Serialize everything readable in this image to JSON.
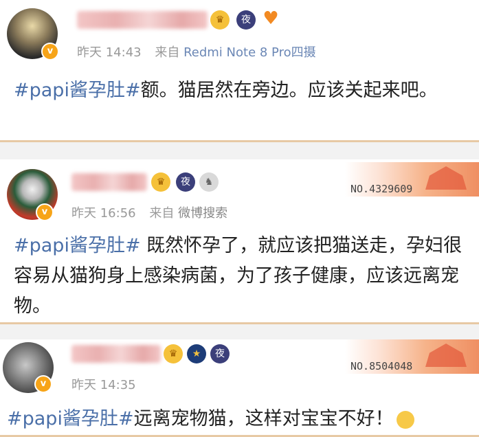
{
  "posts": [
    {
      "time": "昨天 14:43",
      "source_prefix": "来自",
      "source": "Redmi Note 8 Pro四摄",
      "hashtag": "#papi酱孕肚#",
      "text": "额。猫居然在旁边。应该关起来吧。",
      "badges": [
        "crown-icon",
        "night-icon",
        "heart-icon"
      ],
      "verified_mark": "v"
    },
    {
      "time": "昨天 16:56",
      "source_prefix": "来自",
      "source": "微博搜索",
      "hashtag": "#papi酱孕肚#",
      "text": " 既然怀孕了，就应该把猫送走，孕妇很容易从猫狗身上感染病菌，为了孩子健康，应该远离宠物。",
      "badge_no": "NO.4329609",
      "badges": [
        "crown-icon",
        "night-icon",
        "silver-medal-icon"
      ],
      "verified_mark": "v"
    },
    {
      "time": "昨天 14:35",
      "source_prefix": "",
      "source": "",
      "hashtag": "#papi酱孕肚#",
      "text": "远离宠物猫，这样对宝宝不好！",
      "badge_no": "NO.8504048",
      "badges": [
        "crown-icon",
        "star-icon",
        "night-icon"
      ],
      "verified_mark": "v"
    }
  ],
  "icons": {
    "crown": "♛",
    "night": "夜",
    "heart": "♥",
    "silver": "♞",
    "star": "★"
  },
  "colors": {
    "hashtag": "#4a6fa8",
    "verified": "#f7a418",
    "border": "#e7c9a4"
  }
}
